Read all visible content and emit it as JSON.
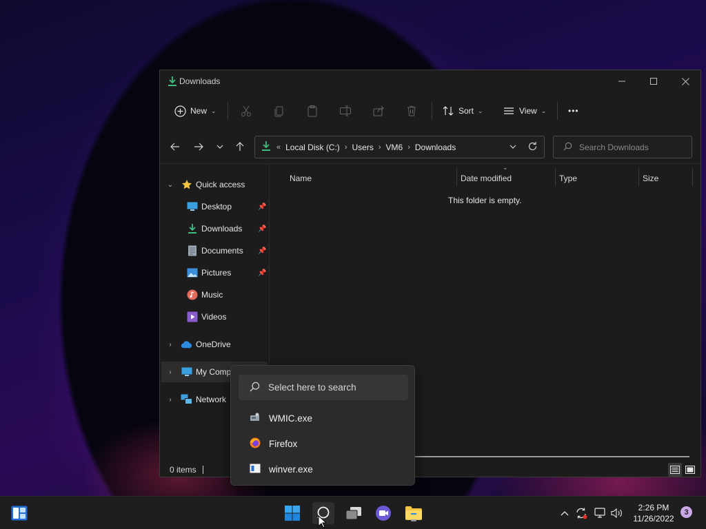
{
  "window": {
    "title": "Downloads",
    "toolbar": {
      "new_label": "New",
      "sort_label": "Sort",
      "view_label": "View",
      "more_label": "•••"
    },
    "address": {
      "overflow": "«",
      "crumbs": [
        "Local Disk (C:)",
        "Users",
        "VM6",
        "Downloads"
      ]
    },
    "search": {
      "placeholder": "Search Downloads"
    },
    "sidebar": {
      "quick_access": "Quick access",
      "items": [
        {
          "label": "Desktop",
          "pinned": true
        },
        {
          "label": "Downloads",
          "pinned": true
        },
        {
          "label": "Documents",
          "pinned": true
        },
        {
          "label": "Pictures",
          "pinned": true
        },
        {
          "label": "Music",
          "pinned": false
        },
        {
          "label": "Videos",
          "pinned": false
        }
      ],
      "onedrive": "OneDrive",
      "my_computer": "My Comp",
      "network": "Network"
    },
    "columns": {
      "name": "Name",
      "date_modified": "Date modified",
      "type": "Type",
      "size": "Size"
    },
    "empty_message": "This folder is empty.",
    "status": {
      "items": "0 items"
    }
  },
  "flyout": {
    "search_placeholder": "Select here to search",
    "items": [
      {
        "label": "WMIC.exe",
        "icon": "wmic-icon"
      },
      {
        "label": "Firefox",
        "icon": "firefox-icon"
      },
      {
        "label": "winver.exe",
        "icon": "winver-icon"
      }
    ]
  },
  "taskbar": {
    "time": "2:26 PM",
    "date": "11/26/2022",
    "notification_count": "3"
  },
  "colors": {
    "accent": "#0078d4",
    "download_green": "#3fbf7f",
    "folder_yellow": "#f5c542"
  }
}
